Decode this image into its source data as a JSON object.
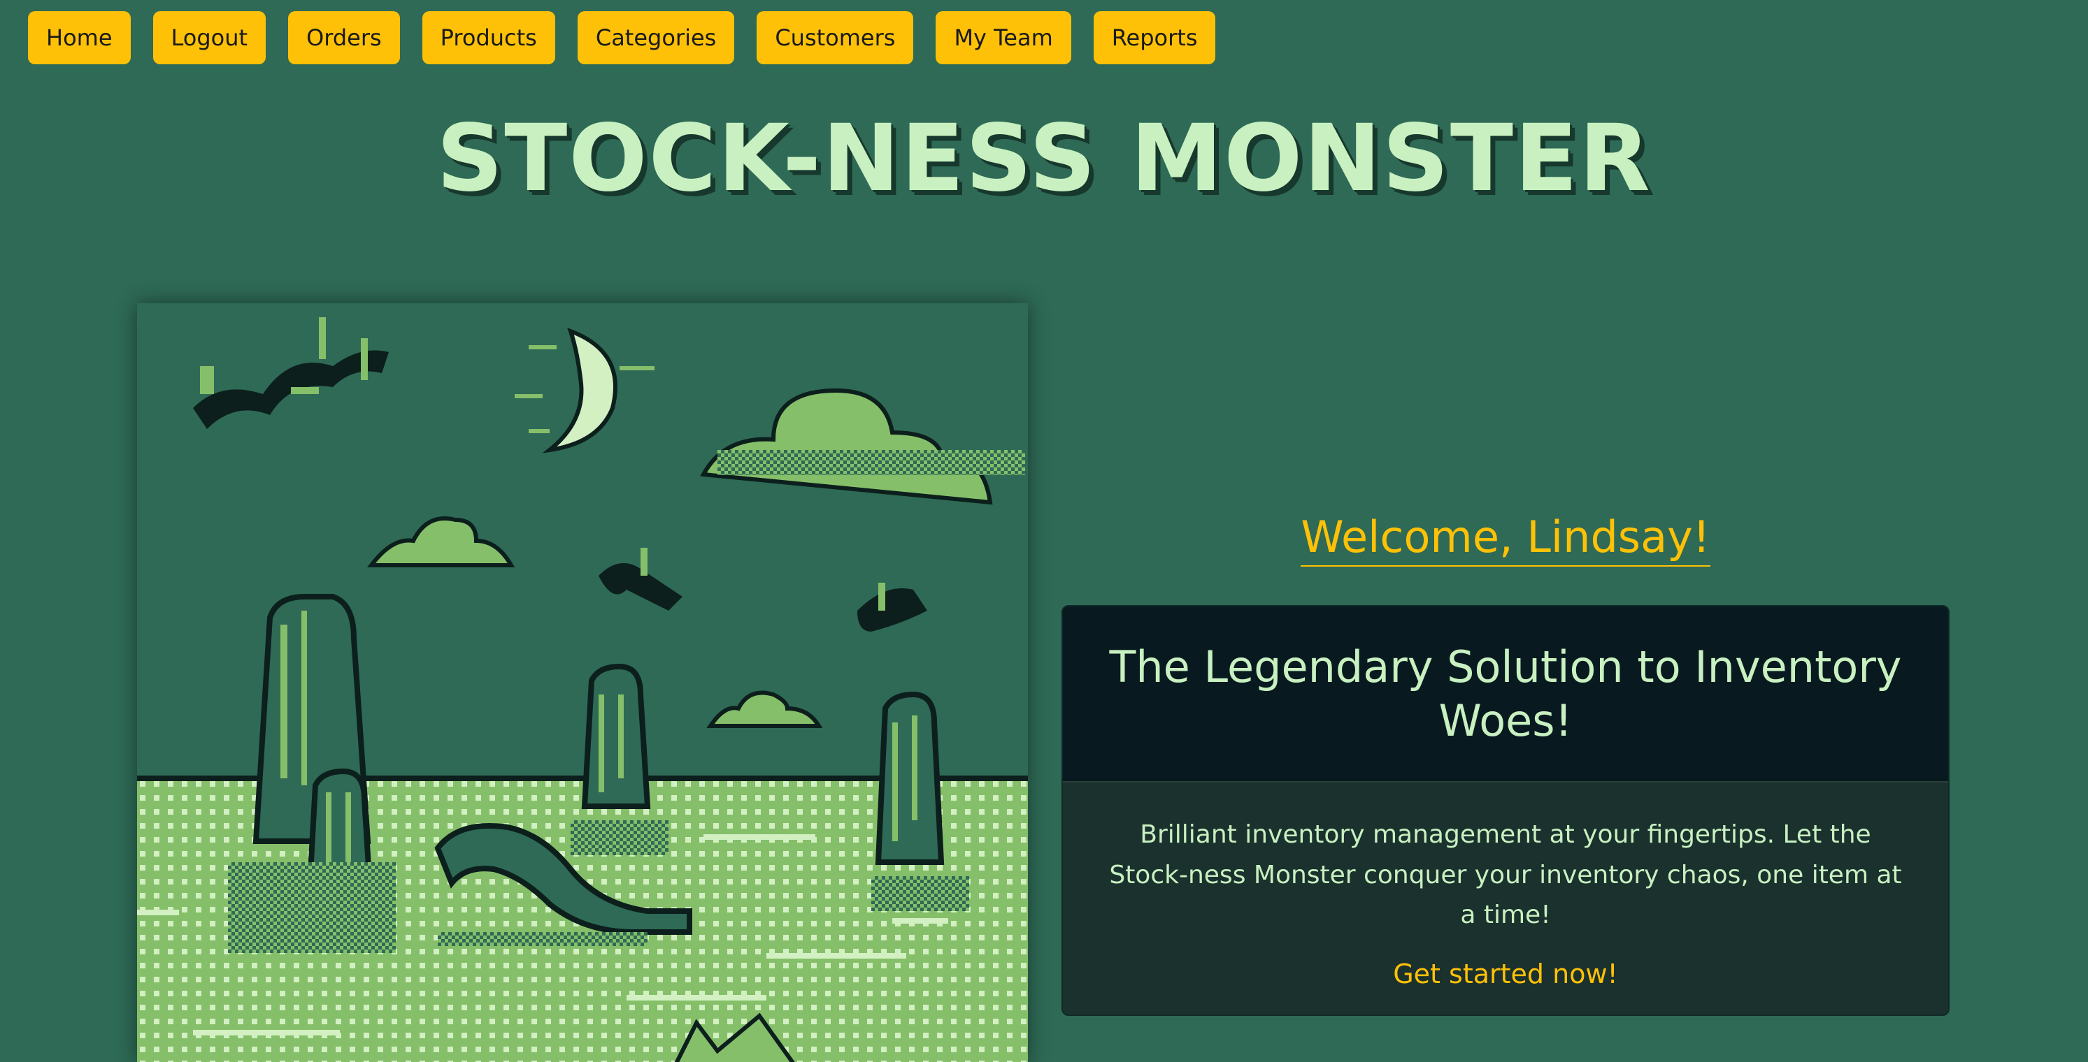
{
  "nav": {
    "items": [
      "Home",
      "Logout",
      "Orders",
      "Products",
      "Categories",
      "Customers",
      "My Team",
      "Reports"
    ]
  },
  "header": {
    "title": "STOCK-NESS MONSTER"
  },
  "welcome": {
    "text": "Welcome, Lindsay!"
  },
  "card": {
    "heading": "The Legendary Solution to Inventory Woes!",
    "body": "Brilliant inventory management at your fingertips. Let the Stock-ness Monster conquer your inventory chaos, one item at a time!",
    "cta": "Get started now!"
  },
  "colors": {
    "background": "#2e6a55",
    "accent": "#ffc107",
    "title": "#c8f0c0",
    "card_header": "#081a20",
    "card_body": "#1b312e"
  }
}
